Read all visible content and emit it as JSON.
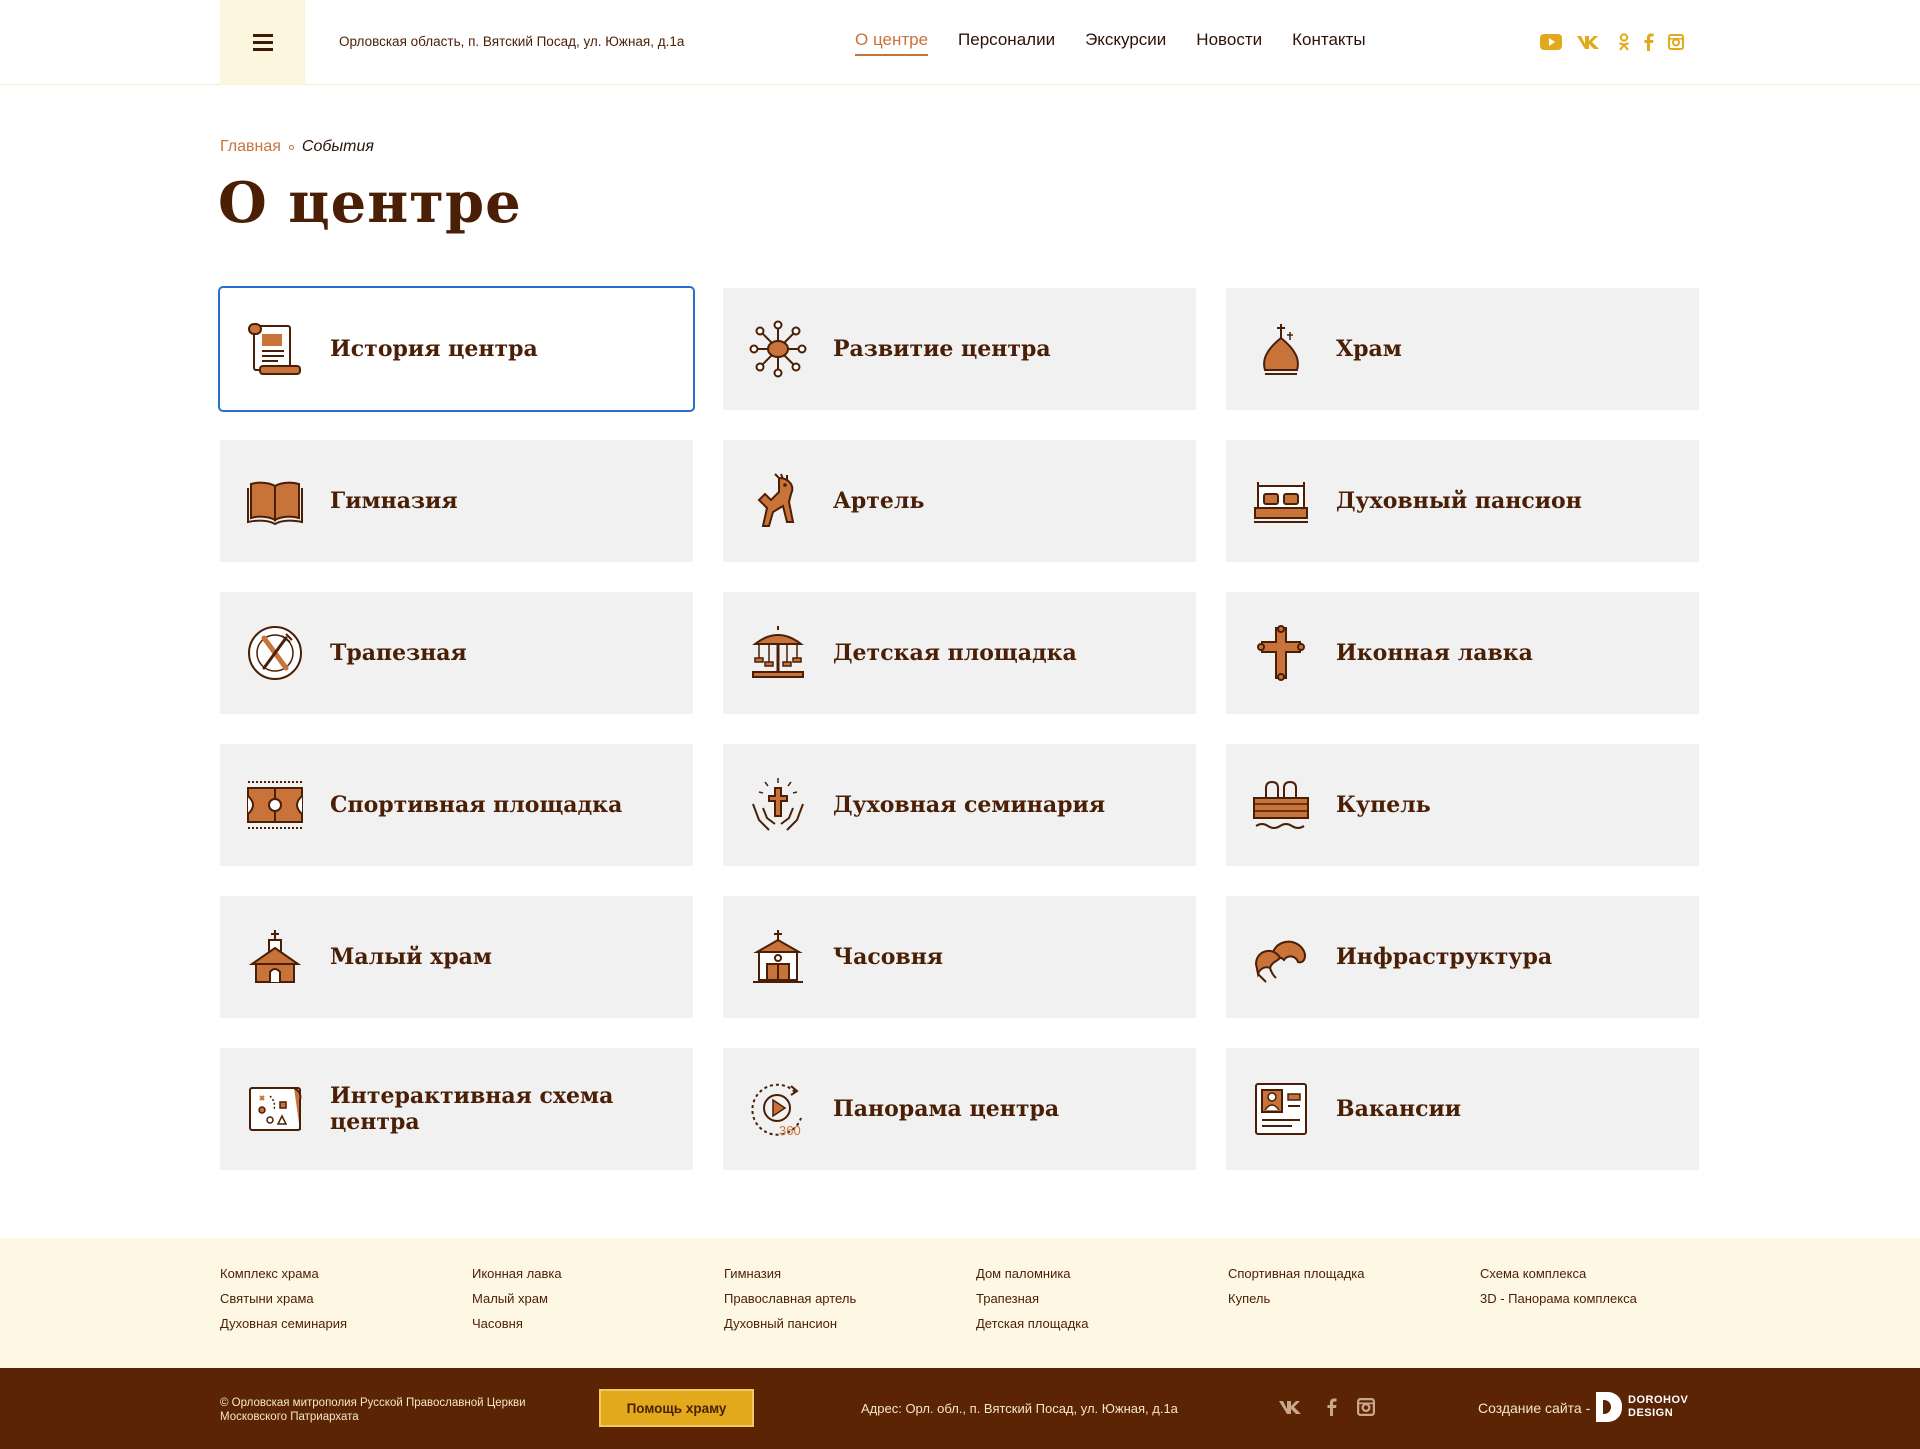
{
  "header": {
    "address": "Орловская область, п. Вятский Посад, ул. Южная, д.1а",
    "nav": [
      {
        "label": "О центре",
        "active": true
      },
      {
        "label": "Персоналии"
      },
      {
        "label": "Экскурсии"
      },
      {
        "label": "Новости"
      },
      {
        "label": "Контакты"
      }
    ],
    "social_icons": [
      "youtube-icon",
      "vk-icon",
      "odnoklassniki-icon",
      "facebook-icon",
      "instagram-icon"
    ]
  },
  "breadcrumb": {
    "home": "Главная",
    "current": "События"
  },
  "page_title": "О центре",
  "cards": [
    {
      "label": "История центра",
      "icon": "scroll-icon"
    },
    {
      "label": "Развитие центра",
      "icon": "network-icon"
    },
    {
      "label": "Храм",
      "icon": "church-dome-icon"
    },
    {
      "label": "Гимназия",
      "icon": "book-icon"
    },
    {
      "label": "Артель",
      "icon": "wooden-horse-icon"
    },
    {
      "label": "Духовный пансион",
      "icon": "bed-icon"
    },
    {
      "label": "Трапезная",
      "icon": "plate-cutlery-icon"
    },
    {
      "label": "Детская площадка",
      "icon": "carousel-icon"
    },
    {
      "label": "Иконная лавка",
      "icon": "cross-icon"
    },
    {
      "label": "Спортивная площадка",
      "icon": "court-icon"
    },
    {
      "label": "Духовная семинария",
      "icon": "hands-cross-icon"
    },
    {
      "label": "Купель",
      "icon": "pool-icon"
    },
    {
      "label": "Малый храм",
      "icon": "small-church-icon"
    },
    {
      "label": "Часовня",
      "icon": "chapel-icon"
    },
    {
      "label": "Инфраструктура",
      "icon": "domes-icon"
    },
    {
      "label": "Интерактивная схема центра",
      "icon": "map-icon"
    },
    {
      "label": "Панорама центра",
      "icon": "panorama-360-icon",
      "badge": "360"
    },
    {
      "label": "Вакансии",
      "icon": "resume-icon"
    }
  ],
  "footer_links": [
    [
      "Комплекс храма",
      "Святыни храма",
      "Духовная семинария"
    ],
    [
      "Иконная лавка",
      "Малый храм",
      "Часовня"
    ],
    [
      "Гимназия",
      "Православная артель",
      "Духовный пансион"
    ],
    [
      "Дом паломника",
      "Трапезная",
      "Детская площадка"
    ],
    [
      "Спортивная площадка",
      "Купель"
    ],
    [
      "Схема комплекса",
      "3D - Панорама комплекса"
    ]
  ],
  "footer": {
    "copyright": "© Орловская митрополия Русской Православной Церкви Московского Патриархата",
    "help_button": "Помощь храму",
    "address": "Адрес: Орл. обл., п. Вятский Посад, ул. Южная, д.1а",
    "social_icons": [
      "vk-icon",
      "facebook-icon",
      "instagram-icon"
    ],
    "created_by": "Создание сайта -",
    "studio_line1": "DOROHOV",
    "studio_line2": "DESIGN"
  },
  "colors": {
    "brown": "#4a1f06",
    "accent": "#c8733a",
    "gold": "#e2a91c",
    "card_bg": "#f1f1f1",
    "footer_bg": "#5a2405",
    "cream": "#fdf7e3",
    "selection": "#2a6fd0"
  }
}
